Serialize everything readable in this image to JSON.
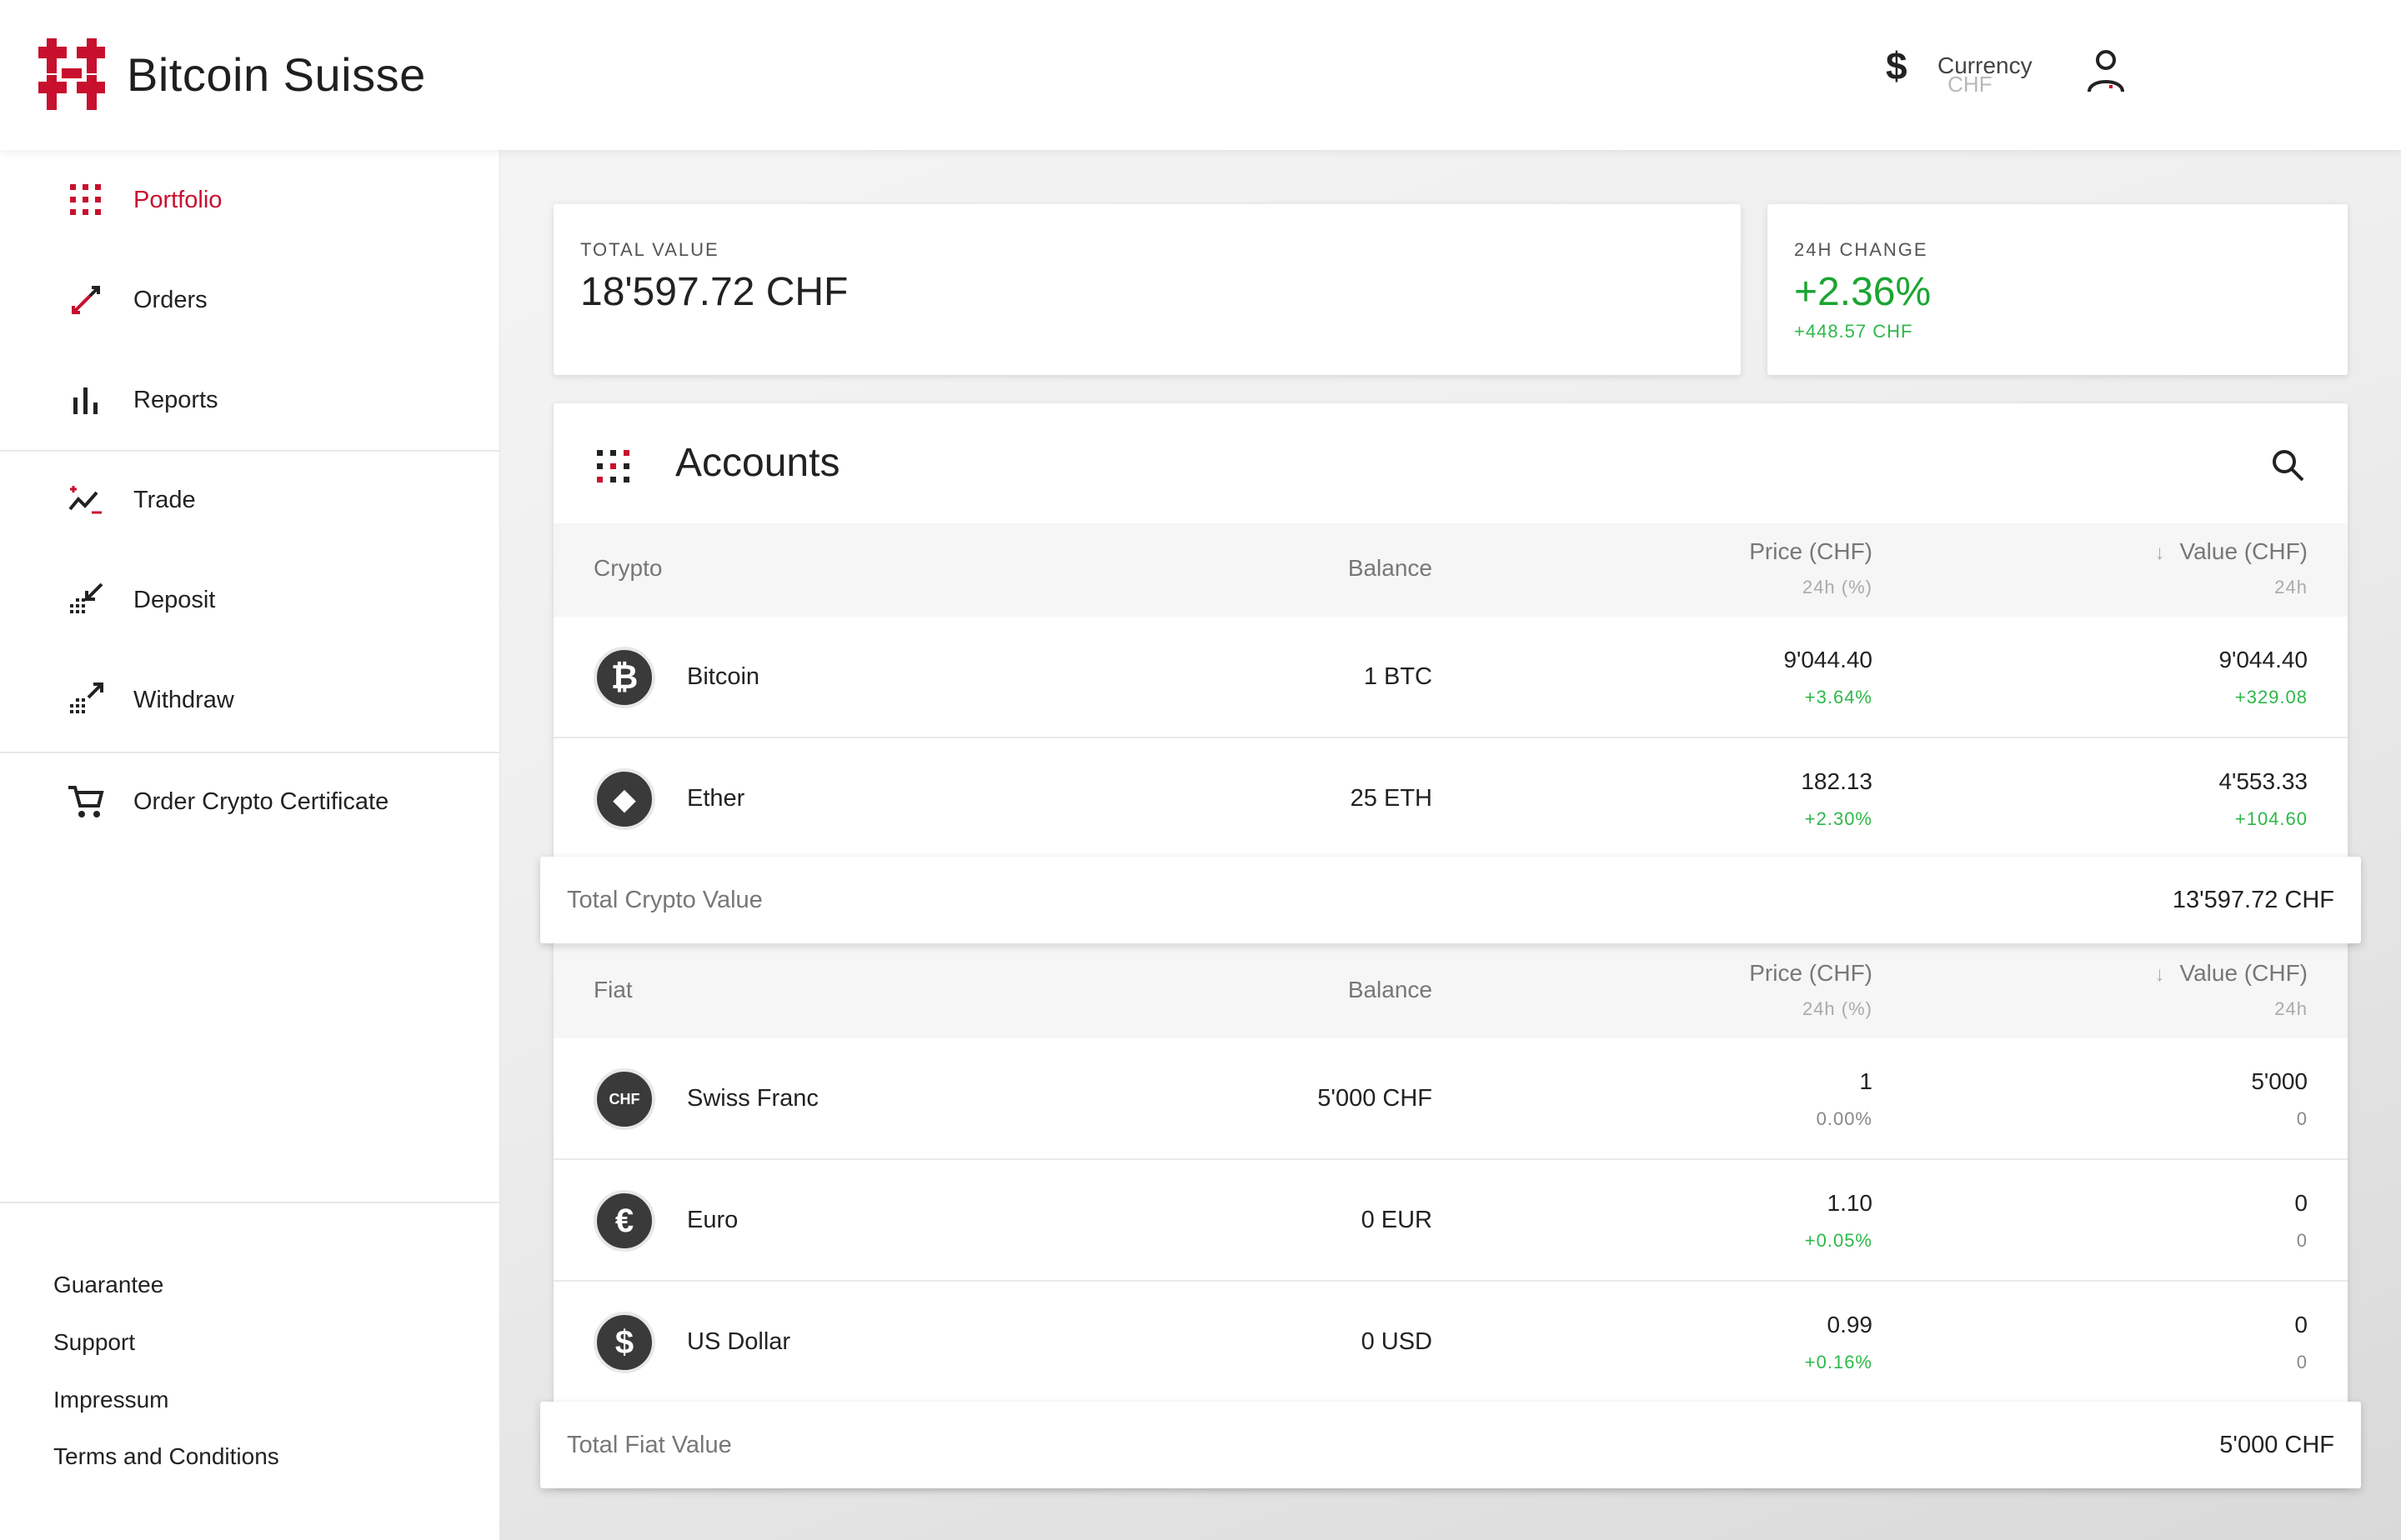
{
  "brand": {
    "name": "Bitcoin Suisse",
    "accent": "#c8102e"
  },
  "header": {
    "currency_label": "Currency",
    "currency_value": "CHF",
    "currency_icon": "$"
  },
  "sidebar": {
    "items": [
      {
        "label": "Portfolio",
        "icon": "grid-icon",
        "active": true
      },
      {
        "label": "Orders",
        "icon": "arrows-icon"
      },
      {
        "label": "Reports",
        "icon": "bar-chart-icon"
      },
      {
        "label": "Trade",
        "icon": "trade-icon"
      },
      {
        "label": "Deposit",
        "icon": "deposit-icon"
      },
      {
        "label": "Withdraw",
        "icon": "withdraw-icon"
      },
      {
        "label": "Order Crypto Certificate",
        "icon": "cart-icon"
      }
    ],
    "footer": [
      "Guarantee",
      "Support",
      "Impressum",
      "Terms and Conditions"
    ]
  },
  "summary": {
    "total_label": "TOTAL VALUE",
    "total_value": "18'597.72 CHF",
    "change_label": "24H CHANGE",
    "change_value": "+2.36%",
    "change_sub": "+448.57 CHF"
  },
  "accounts": {
    "title": "Accounts",
    "crypto_header": {
      "col1": "Crypto",
      "balance": "Balance",
      "price": "Price (CHF)",
      "price_sub": "24h (%)",
      "value": "Value (CHF)",
      "value_sub": "24h"
    },
    "crypto_rows": [
      {
        "name": "Bitcoin",
        "symbol": "₿",
        "balance": "1 BTC",
        "price": "9'044.40",
        "price_change": "+3.64%",
        "value": "9'044.40",
        "value_change": "+329.08"
      },
      {
        "name": "Ether",
        "symbol": "◆",
        "balance": "25 ETH",
        "price": "182.13",
        "price_change": "+2.30%",
        "value": "4'553.33",
        "value_change": "+104.60"
      }
    ],
    "crypto_total_label": "Total Crypto Value",
    "crypto_total_value": "13'597.72 CHF",
    "fiat_header": {
      "col1": "Fiat",
      "balance": "Balance",
      "price": "Price (CHF)",
      "price_sub": "24h (%)",
      "value": "Value (CHF)",
      "value_sub": "24h"
    },
    "fiat_rows": [
      {
        "name": "Swiss Franc",
        "symbol": "CHF",
        "balance": "5'000 CHF",
        "price": "1",
        "price_change": "0.00%",
        "value": "5'000",
        "value_change": "0"
      },
      {
        "name": "Euro",
        "symbol": "€",
        "balance": "0 EUR",
        "price": "1.10",
        "price_change": "+0.05%",
        "value": "0",
        "value_change": "0"
      },
      {
        "name": "US Dollar",
        "symbol": "$",
        "balance": "0 USD",
        "price": "0.99",
        "price_change": "+0.16%",
        "value": "0",
        "value_change": "0"
      }
    ],
    "fiat_total_label": "Total Fiat Value",
    "fiat_total_value": "5'000 CHF"
  }
}
